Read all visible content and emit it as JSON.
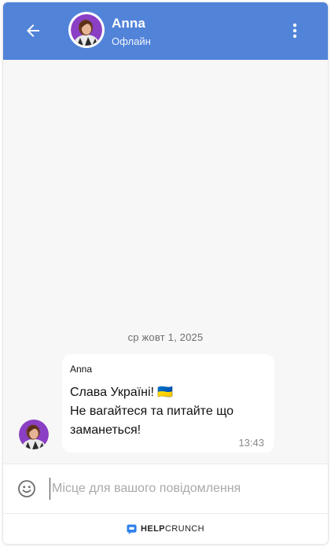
{
  "header": {
    "agent_name": "Anna",
    "status": "Офлайн",
    "icons": {
      "back": "arrow-left-icon",
      "menu": "more-vertical-icon"
    },
    "background_color": "#5183d9"
  },
  "chat": {
    "date_separator": "ср жовт 1, 2025",
    "messages": [
      {
        "author": "Anna",
        "text": "Слава Україні! 🇺🇦\nНе вагайтеся та питайте що заманеться!",
        "time": "13:43"
      }
    ]
  },
  "composer": {
    "placeholder": "Місце для вашого повідомлення",
    "value": "",
    "emoji_icon": "smiley-icon"
  },
  "footer": {
    "brand_part1": "HELP",
    "brand_part2": "CRUNCH",
    "brand_icon": "helpcrunch-logo-icon",
    "brand_color": "#2f80ed"
  }
}
